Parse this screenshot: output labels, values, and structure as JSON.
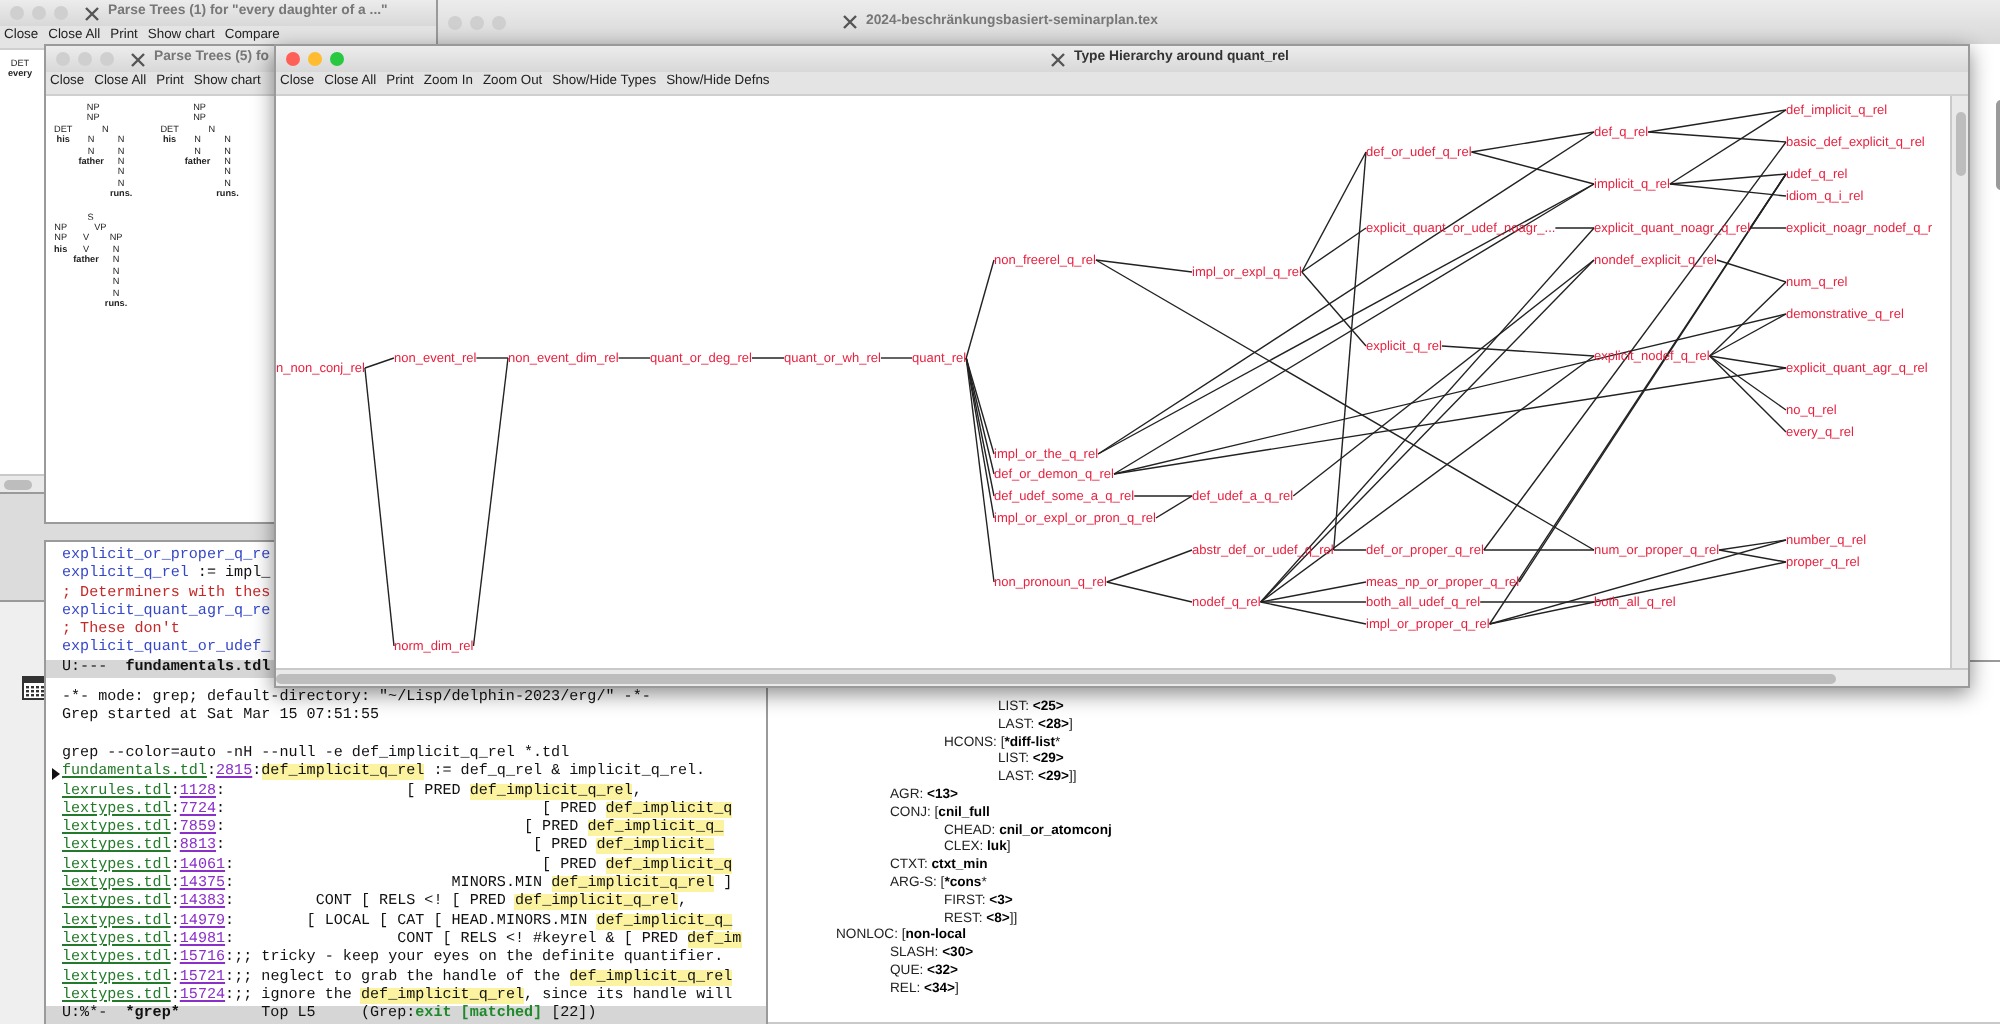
{
  "parse_trees_1": {
    "title": "Parse Trees (1) for \"every daughter of a ...\"",
    "active": false,
    "toolbar": [
      "Close",
      "Close All",
      "Print",
      "Show chart",
      "Compare"
    ],
    "trees": [
      {
        "label": "DET",
        "children": [
          {
            "label": "every"
          }
        ]
      }
    ]
  },
  "tex_window": {
    "title": "2024-beschränkungsbasiert-seminarplan.tex",
    "active": false
  },
  "parse_trees_5": {
    "title": "Parse Trees (5) fo",
    "active": false,
    "toolbar": [
      "Close",
      "Close All",
      "Print",
      "Show chart"
    ],
    "trees": [
      {
        "label": "NP",
        "children": [
          {
            "label": "NP",
            "children": [
              {
                "label": "DET",
                "children": [
                  {
                    "label": "his"
                  }
                ]
              },
              {
                "label": "N",
                "children": [
                  {
                    "label": "N",
                    "children": [
                      {
                        "label": "N",
                        "children": [
                          {
                            "label": "father"
                          }
                        ]
                      }
                    ]
                  },
                  {
                    "label": "N",
                    "children": [
                      {
                        "label": "N",
                        "children": [
                          {
                            "label": "N",
                            "children": [
                              {
                                "label": "N",
                                "children": [
                                  {
                                    "label": "N",
                                    "children": [
                                      {
                                        "label": "runs."
                                      }
                                    ]
                                  }
                                ]
                              }
                            ]
                          }
                        ]
                      }
                    ]
                  }
                ]
              }
            ]
          }
        ]
      },
      {
        "label": "NP",
        "children": [
          {
            "label": "NP",
            "children": [
              {
                "label": "DET",
                "children": [
                  {
                    "label": "his"
                  }
                ]
              },
              {
                "label": "N",
                "children": [
                  {
                    "label": "N",
                    "children": [
                      {
                        "label": "N",
                        "children": [
                          {
                            "label": "father"
                          }
                        ]
                      }
                    ]
                  },
                  {
                    "label": "N",
                    "children": [
                      {
                        "label": "N",
                        "children": [
                          {
                            "label": "N",
                            "children": [
                              {
                                "label": "N",
                                "children": [
                                  {
                                    "label": "N",
                                    "children": [
                                      {
                                        "label": "runs."
                                      }
                                    ]
                                  }
                                ]
                              }
                            ]
                          }
                        ]
                      }
                    ]
                  }
                ]
              }
            ]
          }
        ]
      },
      {
        "label": "S",
        "children": [
          {
            "label": "NP",
            "children": [
              {
                "label": "NP",
                "children": [
                  {
                    "label": "his"
                  }
                ]
              }
            ]
          },
          {
            "label": "VP",
            "children": [
              {
                "label": "V",
                "children": [
                  {
                    "label": "V",
                    "children": [
                      {
                        "label": "father"
                      }
                    ]
                  }
                ]
              },
              {
                "label": "NP",
                "children": [
                  {
                    "label": "N",
                    "children": [
                      {
                        "label": "N",
                        "children": [
                          {
                            "label": "N",
                            "children": [
                              {
                                "label": "N",
                                "children": [
                                  {
                                    "label": "N",
                                    "children": [
                                      {
                                        "label": "runs."
                                      }
                                    ]
                                  }
                                ]
                              }
                            ]
                          }
                        ]
                      }
                    ]
                  }
                ]
              }
            ]
          }
        ]
      }
    ]
  },
  "type_hierarchy": {
    "title": "Type Hierarchy around quant_rel",
    "active": true,
    "toolbar": [
      "Close",
      "Close All",
      "Print",
      "Zoom In",
      "Zoom Out",
      "Show/Hide Types",
      "Show/Hide Defns"
    ],
    "nodes": [
      {
        "label": "n_non_conj_rel"
      },
      {
        "label": "non_event_rel"
      },
      {
        "label": "non_event_dim_rel"
      },
      {
        "label": "quant_or_deg_rel"
      },
      {
        "label": "quant_or_wh_rel"
      },
      {
        "label": "quant_rel"
      },
      {
        "label": "norm_dim_rel"
      },
      {
        "label": "non_freerel_q_rel"
      },
      {
        "label": "impl_or_the_q_rel"
      },
      {
        "label": "def_or_demon_q_rel"
      },
      {
        "label": "def_udef_some_a_q_rel"
      },
      {
        "label": "impl_or_expl_or_pron_q_rel"
      },
      {
        "label": "non_pronoun_q_rel"
      },
      {
        "label": "impl_or_expl_q_rel"
      },
      {
        "label": "def_udef_a_q_rel"
      },
      {
        "label": "abstr_def_or_udef_q_rel"
      },
      {
        "label": "nodef_q_rel"
      },
      {
        "label": "def_or_udef_q_rel"
      },
      {
        "label": "explicit_quant_or_udef_noagr_..."
      },
      {
        "label": "explicit_q_rel"
      },
      {
        "label": "def_or_proper_q_rel"
      },
      {
        "label": "meas_np_or_proper_q_rel"
      },
      {
        "label": "both_all_udef_q_rel"
      },
      {
        "label": "impl_or_proper_q_rel"
      },
      {
        "label": "def_q_rel"
      },
      {
        "label": "implicit_q_rel"
      },
      {
        "label": "explicit_quant_noagr_q_rel"
      },
      {
        "label": "nondef_explicit_q_rel"
      },
      {
        "label": "explicit_nodef_q_rel"
      },
      {
        "label": "num_or_proper_q_rel"
      },
      {
        "label": "both_all_q_rel"
      },
      {
        "label": "def_implicit_q_rel"
      },
      {
        "label": "basic_def_explicit_q_rel"
      },
      {
        "label": "udef_q_rel"
      },
      {
        "label": "idiom_q_i_rel"
      },
      {
        "label": "explicit_noagr_nodef_q_r"
      },
      {
        "label": "num_q_rel"
      },
      {
        "label": "demonstrative_q_rel"
      },
      {
        "label": "explicit_quant_agr_q_rel"
      },
      {
        "label": "no_q_rel"
      },
      {
        "label": "every_q_rel"
      },
      {
        "label": "number_q_rel"
      },
      {
        "label": "proper_q_rel"
      }
    ]
  },
  "emacs": {
    "upper_lines": [
      [
        {
          "kind": "type",
          "text": "explicit_or_proper_q_re"
        }
      ],
      [
        {
          "kind": "type",
          "text": "explicit_q_rel"
        },
        {
          "kind": "plain",
          "text": " := impl_"
        }
      ],
      [
        {
          "kind": "comment",
          "text": "; Determiners with thes"
        }
      ],
      [
        {
          "kind": "type",
          "text": "explicit_quant_agr_q_re"
        }
      ],
      [
        {
          "kind": "comment",
          "text": "; These don't"
        }
      ],
      [
        {
          "kind": "type",
          "text": "explicit_quant_or_udef_"
        }
      ]
    ],
    "upper_mode_line": [
      {
        "kind": "plain",
        "text": "U:---  "
      },
      {
        "kind": "bold",
        "text": "fundamentals.tdl"
      }
    ],
    "grep_header": {
      "mode": "-*- mode: grep; default-directory: \"~/Lisp/delphin-2023/erg/\" -*-",
      "started": "Grep started at Sat Mar 15 07:51:55",
      "command": "grep --color=auto -nH --null -e def_implicit_q_rel *.tdl"
    },
    "results": [
      {
        "current": true,
        "parts": [
          {
            "kind": "file",
            "text": "fundamentals.tdl"
          },
          {
            "kind": "plain",
            "text": ":"
          },
          {
            "kind": "line",
            "text": "2815"
          },
          {
            "kind": "plain",
            "text": ":"
          },
          {
            "kind": "match",
            "text": "def_implicit_q_rel"
          },
          {
            "kind": "plain",
            "text": " := def_q_rel & implicit_q_rel."
          }
        ]
      },
      {
        "current": false,
        "parts": [
          {
            "kind": "file",
            "text": "lexrules.tdl"
          },
          {
            "kind": "plain",
            "text": ":"
          },
          {
            "kind": "line",
            "text": "1128"
          },
          {
            "kind": "plain",
            "text": ":                    [ PRED "
          },
          {
            "kind": "match",
            "text": "def_implicit_q_rel"
          },
          {
            "kind": "plain",
            "text": ","
          }
        ]
      },
      {
        "current": false,
        "parts": [
          {
            "kind": "file",
            "text": "lextypes.tdl"
          },
          {
            "kind": "plain",
            "text": ":"
          },
          {
            "kind": "line",
            "text": "7724"
          },
          {
            "kind": "plain",
            "text": ":                                   [ PRED "
          },
          {
            "kind": "match",
            "text": "def_implicit_q"
          }
        ]
      },
      {
        "current": false,
        "parts": [
          {
            "kind": "file",
            "text": "lextypes.tdl"
          },
          {
            "kind": "plain",
            "text": ":"
          },
          {
            "kind": "line",
            "text": "7859"
          },
          {
            "kind": "plain",
            "text": ":                                 [ PRED "
          },
          {
            "kind": "match",
            "text": "def_implicit_q_"
          }
        ]
      },
      {
        "current": false,
        "parts": [
          {
            "kind": "file",
            "text": "lextypes.tdl"
          },
          {
            "kind": "plain",
            "text": ":"
          },
          {
            "kind": "line",
            "text": "8813"
          },
          {
            "kind": "plain",
            "text": ":                                  [ PRED "
          },
          {
            "kind": "match",
            "text": "def_implicit_"
          }
        ]
      },
      {
        "current": false,
        "parts": [
          {
            "kind": "file",
            "text": "lextypes.tdl"
          },
          {
            "kind": "plain",
            "text": ":"
          },
          {
            "kind": "line",
            "text": "14061"
          },
          {
            "kind": "plain",
            "text": ":                                  [ PRED "
          },
          {
            "kind": "match",
            "text": "def_implicit_q"
          }
        ]
      },
      {
        "current": false,
        "parts": [
          {
            "kind": "file",
            "text": "lextypes.tdl"
          },
          {
            "kind": "plain",
            "text": ":"
          },
          {
            "kind": "line",
            "text": "14375"
          },
          {
            "kind": "plain",
            "text": ":                        MINORS.MIN "
          },
          {
            "kind": "match",
            "text": "def_implicit_q_rel"
          },
          {
            "kind": "plain",
            "text": " ]"
          }
        ]
      },
      {
        "current": false,
        "parts": [
          {
            "kind": "file",
            "text": "lextypes.tdl"
          },
          {
            "kind": "plain",
            "text": ":"
          },
          {
            "kind": "line",
            "text": "14383"
          },
          {
            "kind": "plain",
            "text": ":         CONT [ RELS <! [ PRED "
          },
          {
            "kind": "match",
            "text": "def_implicit_q_rel"
          },
          {
            "kind": "plain",
            "text": ","
          }
        ]
      },
      {
        "current": false,
        "parts": [
          {
            "kind": "file",
            "text": "lextypes.tdl"
          },
          {
            "kind": "plain",
            "text": ":"
          },
          {
            "kind": "line",
            "text": "14979"
          },
          {
            "kind": "plain",
            "text": ":        [ LOCAL [ CAT [ HEAD.MINORS.MIN "
          },
          {
            "kind": "match",
            "text": "def_implicit_q_"
          }
        ]
      },
      {
        "current": false,
        "parts": [
          {
            "kind": "file",
            "text": "lextypes.tdl"
          },
          {
            "kind": "plain",
            "text": ":"
          },
          {
            "kind": "line",
            "text": "14981"
          },
          {
            "kind": "plain",
            "text": ":                  CONT [ RELS <! #keyrel & [ PRED "
          },
          {
            "kind": "match",
            "text": "def_im"
          }
        ]
      },
      {
        "current": false,
        "parts": [
          {
            "kind": "file",
            "text": "lextypes.tdl"
          },
          {
            "kind": "plain",
            "text": ":"
          },
          {
            "kind": "line",
            "text": "15716"
          },
          {
            "kind": "plain",
            "text": ":;; tricky - keep your eyes on the definite quantifier."
          }
        ]
      },
      {
        "current": false,
        "parts": [
          {
            "kind": "file",
            "text": "lextypes.tdl"
          },
          {
            "kind": "plain",
            "text": ":"
          },
          {
            "kind": "line",
            "text": "15721"
          },
          {
            "kind": "plain",
            "text": ":;; neglect to grab the handle of the "
          },
          {
            "kind": "match",
            "text": "def_implicit_q_rel"
          }
        ]
      },
      {
        "current": false,
        "parts": [
          {
            "kind": "file",
            "text": "lextypes.tdl"
          },
          {
            "kind": "plain",
            "text": ":"
          },
          {
            "kind": "line",
            "text": "15724"
          },
          {
            "kind": "plain",
            "text": ":;; ignore the "
          },
          {
            "kind": "match",
            "text": "def_implicit_q_rel"
          },
          {
            "kind": "plain",
            "text": ", since its handle will"
          }
        ]
      }
    ],
    "mode_line": [
      {
        "kind": "plain",
        "text": "U:%*-  "
      },
      {
        "kind": "bold",
        "text": "*grep*"
      },
      {
        "kind": "plain",
        "text": "         Top L5     (Grep:"
      },
      {
        "kind": "ok",
        "text": "exit [matched]"
      },
      {
        "kind": "plain",
        "text": " [22])"
      }
    ]
  },
  "avm": {
    "features": [
      {
        "children": [
          {
            "children": [
              {
                "children": [
                  {
                    "text": "LIST: **<25>**"
                  },
                  {
                    "text": "LAST: **<28>**]"
                  }
                ]
              },
              {
                "text": "HCONS: [***diff-list***",
                "children": [
                  {
                    "text": "LIST: **<29>**"
                  },
                  {
                    "text": "LAST: **<29>**]]"
                  }
                ]
              }
            ]
          },
          {
            "text": "AGR: **<13>**"
          },
          {
            "text": "CONJ: [**cnil_full**",
            "children": [
              {
                "text": "CHEAD: **cnil_or_atomconj**"
              },
              {
                "text": "CLEX: **luk**]"
              }
            ]
          },
          {
            "text": "CTXT: **ctxt_min**"
          },
          {
            "text": "ARG-S: [***cons***",
            "children": [
              {
                "text": "FIRST: **<3>**"
              },
              {
                "text": "REST: **<8>**]]"
              }
            ]
          }
        ]
      },
      {
        "text": "NONLOC: [**non-local**",
        "children": [
          {
            "text": "SLASH: **<30>**"
          },
          {
            "text": "QUE: **<32>**"
          },
          {
            "text": "REL: **<34>**]"
          }
        ]
      }
    ]
  }
}
